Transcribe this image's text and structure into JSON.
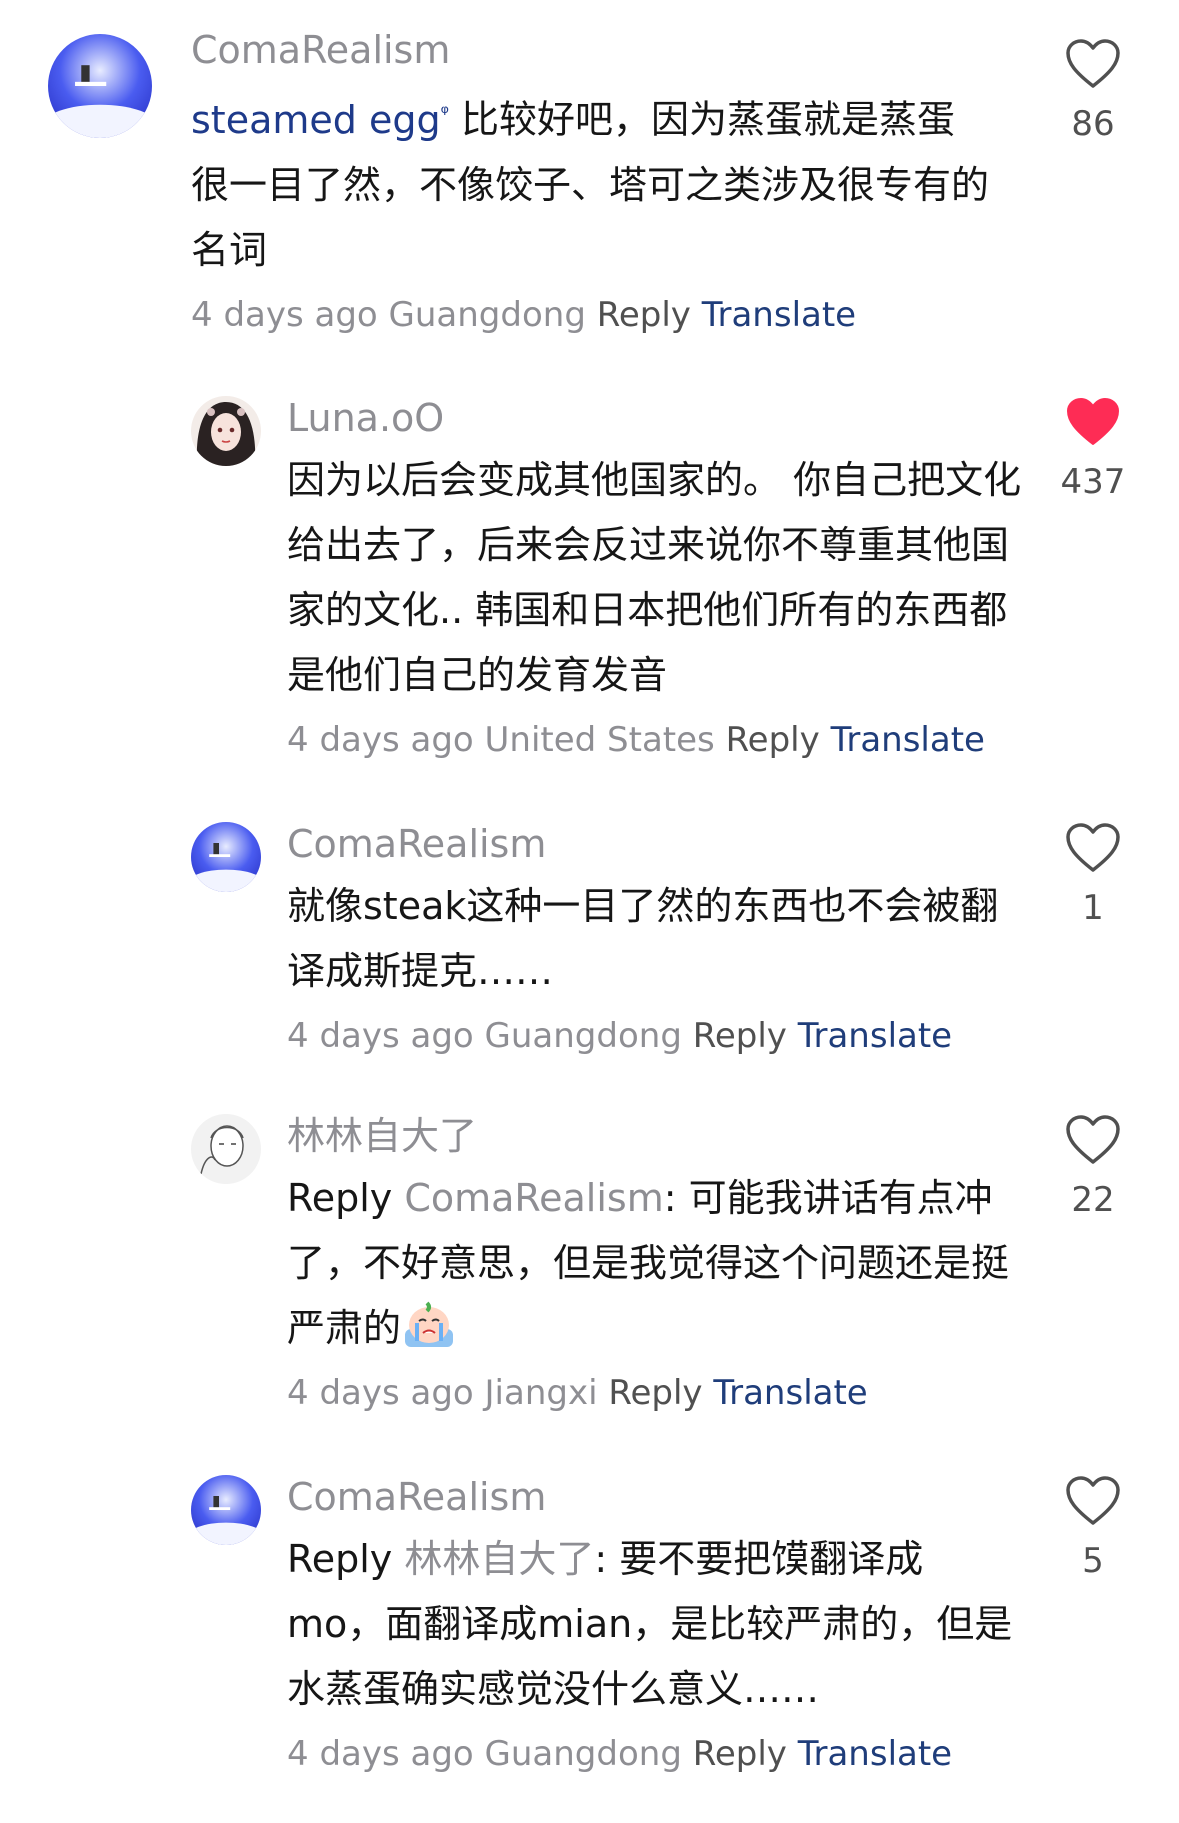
{
  "comments": [
    {
      "username": "ComaRealism",
      "tag": "steamed egg",
      "text": " 比较好吧，因为蒸蛋就是蒸蛋很一目了然，不像饺子、塔可之类涉及很专有的名词",
      "time": "4 days ago",
      "location": "Guangdong",
      "reply": "Reply",
      "translate": "Translate",
      "likes": "86",
      "liked": false
    },
    {
      "username": "Luna.oO",
      "text": "因为以后会变成其他国家的。 你自己把文化给出去了，后来会反过来说你不尊重其他国家的文化.. 韩国和日本把他们所有的东西都是他们自己的发育发音",
      "time": "4 days ago",
      "location": "United States",
      "reply": "Reply",
      "translate": "Translate",
      "likes": "437",
      "liked": true
    },
    {
      "username": "ComaRealism",
      "text": "就像steak这种一目了然的东西也不会被翻译成斯提克……",
      "time": "4 days ago",
      "location": "Guangdong",
      "reply": "Reply",
      "translate": "Translate",
      "likes": "1",
      "liked": false
    },
    {
      "username": "林林自大了",
      "reply_prefix": "Reply",
      "mention": "ComaRealism",
      "text": ": 可能我讲话有点冲了，不好意思，但是我觉得这个问题还是挺严肃的",
      "emoji": "crying-face-emoji",
      "time": "4 days ago",
      "location": "Jiangxi",
      "reply": "Reply",
      "translate": "Translate",
      "likes": "22",
      "liked": false
    },
    {
      "username": "ComaRealism",
      "reply_prefix": "Reply",
      "mention": "林林自大了",
      "text": ": 要不要把馍翻译成 mo，面翻译成mian，是比较严肃的，但是水蒸蛋确实感觉没什么意义……",
      "time": "4 days ago",
      "location": "Guangdong",
      "reply": "Reply",
      "translate": "Translate",
      "likes": "5",
      "liked": false
    }
  ],
  "colors": {
    "heart_liked": "#fe2c55",
    "translate_link": "#1f3d7a",
    "muted": "#8e8e93"
  }
}
